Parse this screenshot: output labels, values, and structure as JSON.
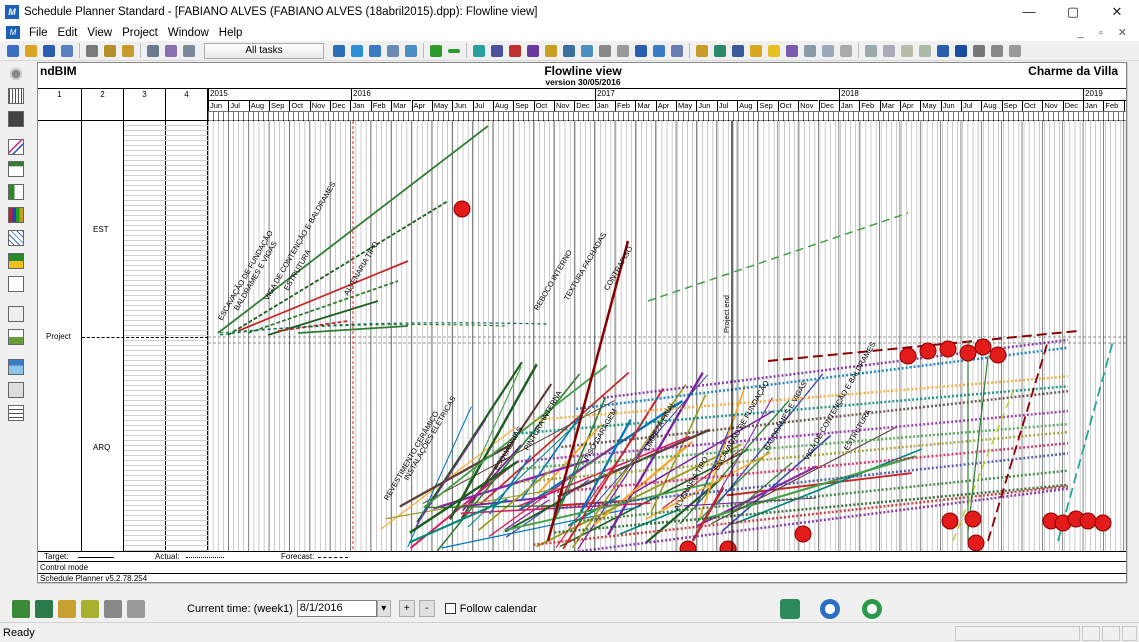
{
  "window": {
    "title": "Schedule Planner Standard - [FABIANO ALVES (FABIANO ALVES (18abril2015).dpp): Flowline view]",
    "minimize": "—",
    "maximize": "▢",
    "close": "✕"
  },
  "menu": {
    "items": [
      "File",
      "Edit",
      "View",
      "Project",
      "Window",
      "Help"
    ],
    "mdi_controls": "_ ▫ ✕"
  },
  "toolbar": {
    "filter_label": "All tasks",
    "icons": [
      "new-icon",
      "open-icon",
      "save-icon",
      "undo-icon",
      "cut-icon",
      "copy-icon",
      "paste-icon",
      "print-icon",
      "print-preview-icon",
      "print-setup-icon"
    ],
    "colors": [
      "#3a6fc4",
      "#d9a520",
      "#2a5db0",
      "#5a7fbf",
      "#7a7a7a",
      "#b58c2a",
      "#3a7a3a",
      "#555",
      "#666",
      "#777"
    ]
  },
  "view_header": {
    "left": "ndBIM",
    "title": "Flowline view",
    "version": "version 30/05/2016",
    "right": "Charme da Villa"
  },
  "columns": [
    "1",
    "2",
    "3",
    "4"
  ],
  "timescale": {
    "years": [
      {
        "label": "2015"
      },
      {
        "label": "2016"
      },
      {
        "label": "2017"
      },
      {
        "label": "2018"
      },
      {
        "label": "2019"
      }
    ],
    "months": [
      "Jun",
      "Jul",
      "Aug",
      "Sep",
      "Oct",
      "Nov",
      "Dec",
      "Jan",
      "Feb",
      "Mar",
      "Apr",
      "May",
      "Jun",
      "Jul",
      "Aug",
      "Sep",
      "Oct",
      "Nov",
      "Dec",
      "Jan",
      "Feb",
      "Mar",
      "Apr",
      "May",
      "Jun",
      "Jul",
      "Aug",
      "Sep",
      "Oct",
      "Nov",
      "Dec",
      "Jan",
      "Feb",
      "Mar",
      "Apr",
      "May",
      "Jun",
      "Jul",
      "Aug",
      "Sep",
      "Oct",
      "Nov",
      "Dec",
      "Jan",
      "Feb",
      "M"
    ]
  },
  "lanes": {
    "col1": "Project",
    "est": "EST",
    "arq": "ARQ"
  },
  "chart": {
    "project_end_label": "Project end",
    "activity_labels": [
      "ESCAVAÇÃO DE FUNDAÇÃO",
      "BALDRAMES E VIGAS",
      "VIGA DE CONTENÇÃO E BALDRAMES",
      "ESTRUTURA",
      "ALVENARIA TIPO",
      "REBOCO INTERNO",
      "TEXTURA FACHADAS",
      "CONTRAPISO",
      "REVESTIMENTO CERÂMICO",
      "INSTALAÇÕES ELÉTRICAS",
      "ESQUADRIAS",
      "PINTURA INTERNA",
      "PISO GARAGEM",
      "LIMPEZA FINAL"
    ],
    "line_colors": [
      "#2e7d32",
      "#1b5e20",
      "#c62828",
      "#7b1fa2",
      "#0277bd",
      "#f9a825",
      "#00897b",
      "#5d4037",
      "#8e24aa",
      "#43a047",
      "#9e9d24",
      "#d81b60",
      "#3949ab"
    ]
  },
  "legend": {
    "target": "Target:",
    "actual": "Actual:",
    "forecast": "Forecast:"
  },
  "control_mode": "Control mode",
  "version_line": "Schedule Planner v5.2.78.254",
  "bottom": {
    "current_time_label": "Current time: (week1)",
    "current_time_value": "8/1/2016",
    "plus": "+",
    "minus": "-",
    "follow_calendar": "Follow calendar"
  },
  "status": {
    "text": "Ready"
  }
}
